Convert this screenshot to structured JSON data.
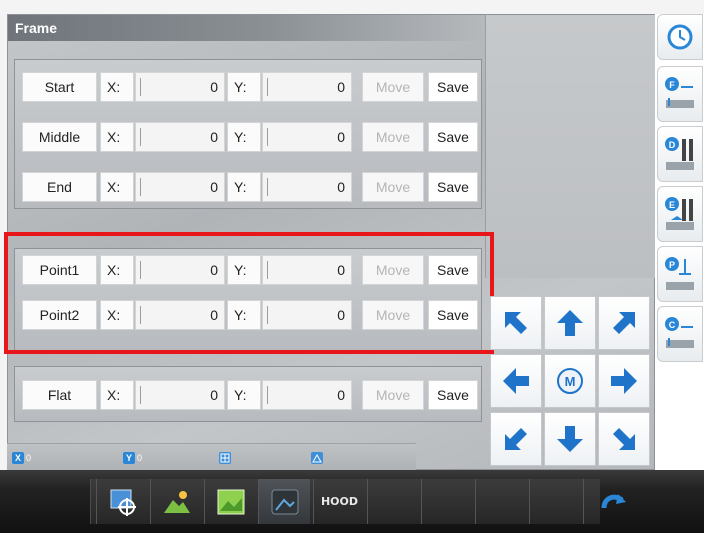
{
  "panel": {
    "title": "Frame"
  },
  "frame_rows": [
    {
      "label": "Start",
      "x_label": "X:",
      "x_value": "0",
      "y_label": "Y:",
      "y_value": "0",
      "move_label": "Move",
      "save_label": "Save"
    },
    {
      "label": "Middle",
      "x_label": "X:",
      "x_value": "0",
      "y_label": "Y:",
      "y_value": "0",
      "move_label": "Move",
      "save_label": "Save"
    },
    {
      "label": "End",
      "x_label": "X:",
      "x_value": "0",
      "y_label": "Y:",
      "y_value": "0",
      "move_label": "Move",
      "save_label": "Save"
    }
  ],
  "point_rows": [
    {
      "label": "Point1",
      "x_label": "X:",
      "x_value": "0",
      "y_label": "Y:",
      "y_value": "0",
      "move_label": "Move",
      "save_label": "Save"
    },
    {
      "label": "Point2",
      "x_label": "X:",
      "x_value": "0",
      "y_label": "Y:",
      "y_value": "0",
      "move_label": "Move",
      "save_label": "Save"
    }
  ],
  "flat_row": {
    "label": "Flat",
    "x_label": "X:",
    "x_value": "0",
    "y_label": "Y:",
    "y_value": "0",
    "move_label": "Move",
    "save_label": "Save"
  },
  "status": {
    "x_letter": "X",
    "x_value": "0",
    "y_letter": "Y",
    "y_value": "0"
  },
  "taskbar": {
    "hood_label": "HOOD"
  },
  "colors": {
    "highlight": "#e8161b",
    "arrow_blue": "#1f74c9",
    "accent_blue": "#2a86d6"
  },
  "icons": {
    "side_toolbar": [
      "clock-icon",
      "point-f-icon",
      "point-d-icon",
      "point-e-icon",
      "point-p-icon",
      "point-c-icon"
    ],
    "arrow_pad": [
      "arrow-up-left-icon",
      "arrow-up-icon",
      "arrow-up-right-icon",
      "arrow-left-icon",
      "home-m-icon",
      "arrow-right-icon",
      "arrow-down-left-icon",
      "arrow-down-icon",
      "arrow-down-right-icon"
    ],
    "taskbar": [
      "crosshair-icon",
      "image-sun-icon",
      "image-green-icon",
      "image-dark-icon",
      "undo-icon"
    ]
  }
}
